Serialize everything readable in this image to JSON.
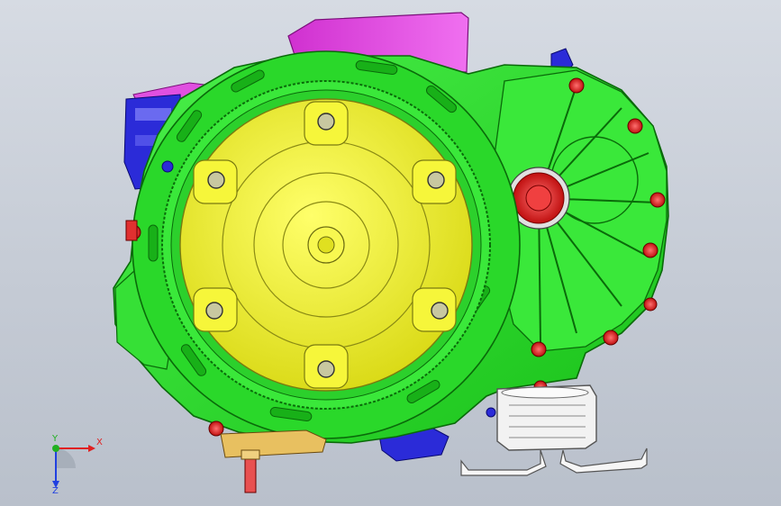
{
  "viewport": {
    "background_top": "#d6dbe3",
    "background_bottom": "#b9c0cb"
  },
  "model": {
    "colors": {
      "housing": "#2ee02e",
      "housing_edge": "#0a6a0a",
      "flexplate": "#f2f226",
      "flexplate_edge": "#7a7a10",
      "cover": "#e040e0",
      "bracket": "#2b2bd8",
      "bolt": "#e02020",
      "cooler": "#f2f2f2",
      "sensor": "#e8c060"
    }
  },
  "triad": {
    "x_label": "X",
    "y_label": "Y",
    "z_label": "Z",
    "x_color": "#e02020",
    "y_color": "#20b020",
    "z_color": "#2040e0"
  }
}
